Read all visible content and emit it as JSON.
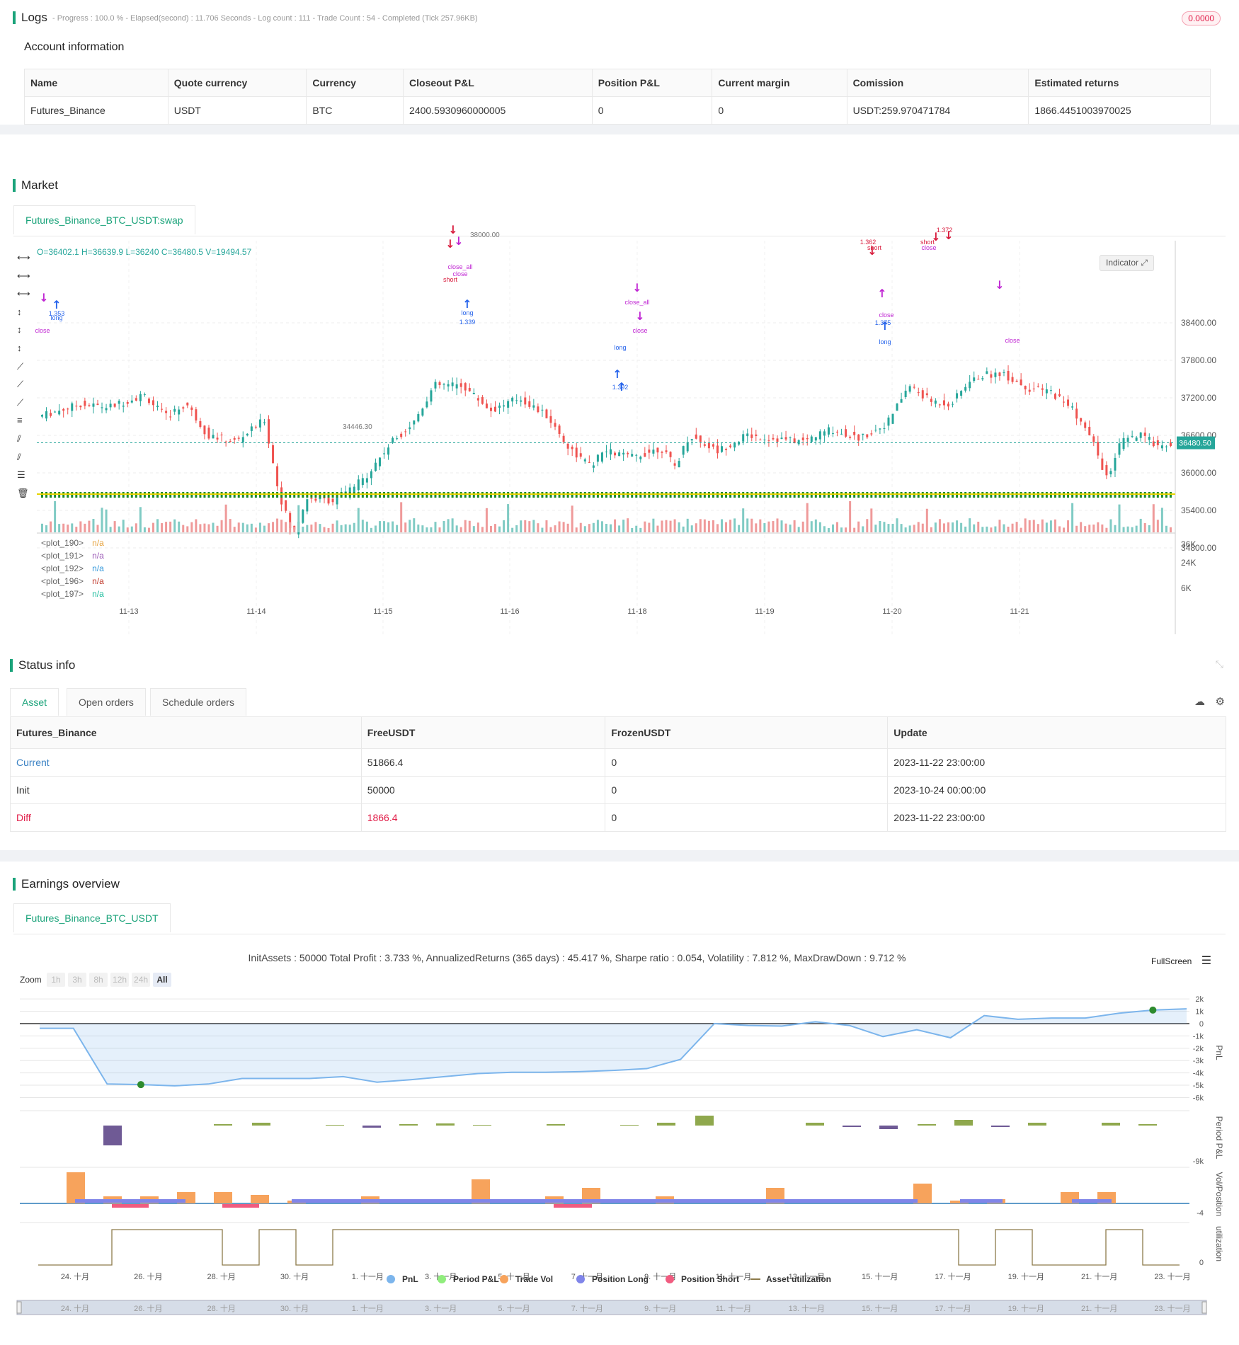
{
  "logs": {
    "title": "Logs",
    "summary": "- Progress : 100.0 % - Elapsed(second) : 11.706 Seconds - Log count : 111 - Trade Count : 54 - Completed (Tick 257.96KB)",
    "badge": "0.0000",
    "account_title": "Account information",
    "columns": [
      "Name",
      "Quote currency",
      "Currency",
      "Closeout P&L",
      "Position P&L",
      "Current margin",
      "Comission",
      "Estimated returns"
    ],
    "row": [
      "Futures_Binance",
      "USDT",
      "BTC",
      "2400.5930960000005",
      "0",
      "0",
      "USDT:259.970471784",
      "1866.4451003970025"
    ]
  },
  "market": {
    "title": "Market",
    "tab": "Futures_Binance_BTC_USDT:swap",
    "ohlc": "O=36402.1 H=36639.9 L=36240 C=36480.5 V=19494.57",
    "indicator_button": "Indicator",
    "price_label": "36480.50",
    "high_label": "38000.00",
    "low_label": "34446.30",
    "price_ticks": [
      "38400.00",
      "37800.00",
      "37200.00",
      "36600.00",
      "36000.00",
      "35400.00",
      "34800.00"
    ],
    "volume_ticks": [
      "36K",
      "24K",
      "6K"
    ],
    "date_ticks": [
      "11-13",
      "11-14",
      "11-15",
      "11-16",
      "11-18",
      "11-19",
      "11-20",
      "11-21"
    ],
    "plots": [
      {
        "name": "<plot_190>",
        "value": "n/a",
        "color": "#e6a23c"
      },
      {
        "name": "<plot_191>",
        "value": "n/a",
        "color": "#9b59b6"
      },
      {
        "name": "<plot_192>",
        "value": "n/a",
        "color": "#3498db"
      },
      {
        "name": "<plot_196>",
        "value": "n/a",
        "color": "#c0392b"
      },
      {
        "name": "<plot_197>",
        "value": "n/a",
        "color": "#1abc9c"
      }
    ],
    "signals": [
      {
        "text": "close_all",
        "color": "#c026d3"
      },
      {
        "text": "close",
        "color": "#c026d3"
      },
      {
        "text": "short",
        "color": "#d81b3c"
      },
      {
        "text": "long",
        "color": "#2563eb"
      },
      {
        "text": "1.353",
        "color": "#2563eb"
      },
      {
        "text": "1.339",
        "color": "#2563eb"
      },
      {
        "text": "1.392",
        "color": "#2563eb"
      },
      {
        "text": "1.375",
        "color": "#2563eb"
      },
      {
        "text": "1.362",
        "color": "#d81b3c"
      },
      {
        "text": "1.372",
        "color": "#d81b3c"
      }
    ]
  },
  "status": {
    "title": "Status info",
    "tabs": [
      "Asset",
      "Open orders",
      "Schedule orders"
    ],
    "columns": [
      "Futures_Binance",
      "FreeUSDT",
      "FrozenUSDT",
      "Update"
    ],
    "rows": [
      {
        "label": "Current",
        "free": "51866.4",
        "frozen": "0",
        "update": "2023-11-22 23:00:00"
      },
      {
        "label": "Init",
        "free": "50000",
        "frozen": "0",
        "update": "2023-10-24 00:00:00"
      },
      {
        "label": "Diff",
        "free": "1866.4",
        "frozen": "0",
        "update": "2023-11-22 23:00:00"
      }
    ]
  },
  "earnings": {
    "title": "Earnings overview",
    "tab": "Futures_Binance_BTC_USDT",
    "summary": "InitAssets : 50000 Total Profit : 3.733 %, AnnualizedReturns (365 days) : 45.417 %, Sharpe ratio : 0.054, Volatility : 7.812 %, MaxDrawDown : 9.712 %",
    "fullscreen": "FullScreen",
    "zoom_label": "Zoom",
    "zoom_buttons": [
      "1h",
      "3h",
      "8h",
      "12h",
      "24h",
      "All"
    ],
    "pnl_ticks": [
      "2k",
      "1k",
      "0",
      "-1k",
      "-2k",
      "-3k",
      "-4k",
      "-5k",
      "-6k"
    ],
    "pnl_axis": "PnL",
    "period_axis": "Period P&L",
    "period_tick": "-9k",
    "vol_axis": "Vol/Position",
    "vol_tick": "-4",
    "util_axis": "utilization",
    "util_tick": "0",
    "date_ticks": [
      "24. 十月",
      "26. 十月",
      "28. 十月",
      "30. 十月",
      "1. 十一月",
      "3. 十一月",
      "5. 十一月",
      "7. 十一月",
      "9. 十一月",
      "11. 十一月",
      "13. 十一月",
      "15. 十一月",
      "17. 十一月",
      "19. 十一月",
      "21. 十一月",
      "23. 十一月"
    ],
    "legend": [
      {
        "name": "PnL",
        "color": "#7cb5ec"
      },
      {
        "name": "Period P&L",
        "color": "#90ed7d"
      },
      {
        "name": "Trade Vol",
        "color": "#f7a35c"
      },
      {
        "name": "Position Long",
        "color": "#8085e9"
      },
      {
        "name": "Position Short",
        "color": "#f15c80"
      },
      {
        "name": "Asset utilization",
        "color": "#8d7b4a"
      }
    ],
    "pnl_series": [
      -380,
      -380,
      -4900,
      -4950,
      -5050,
      -4900,
      -4450,
      -4450,
      -4450,
      -4300,
      -4750,
      -4550,
      -4300,
      -4050,
      -3950,
      -3950,
      -3900,
      -3800,
      -3650,
      -2900,
      0,
      -150,
      -200,
      150,
      -150,
      -1050,
      -500,
      -1150,
      650,
      350,
      450,
      450,
      850,
      1100,
      1200
    ]
  }
}
